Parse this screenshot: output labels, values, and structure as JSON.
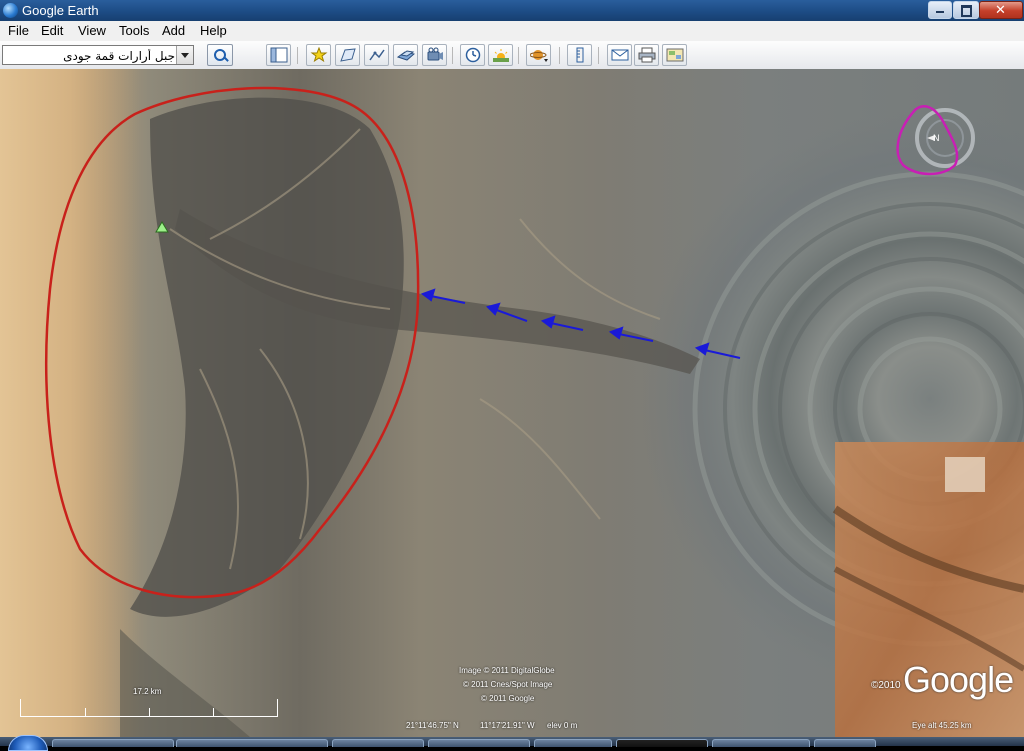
{
  "window": {
    "title": "Google Earth",
    "close_glyph": "✕"
  },
  "menu": {
    "items": [
      "File",
      "Edit",
      "View",
      "Tools",
      "Add",
      "Help"
    ]
  },
  "search": {
    "value": "جبل أرارات قمة جودى"
  },
  "toolbar": {
    "buttons": [
      "sidebar-toggle-icon",
      "add-placemark-icon",
      "add-polygon-icon",
      "add-path-icon",
      "image-overlay-icon",
      "record-tour-icon",
      "historical-imagery-icon",
      "sunlight-icon",
      "switch-planet-icon",
      "ruler-icon",
      "email-icon",
      "print-icon",
      "view-in-maps-icon"
    ]
  },
  "map": {
    "credits": [
      "Image © 2011 DigitalGlobe",
      "© 2011 Cnes/Spot Image",
      "© 2011 Google"
    ],
    "copyright_year": "©2010",
    "logo_text": "Google",
    "scale_label": "17.2 km",
    "status": {
      "lat": "21°11'46.75\" N",
      "lon": "11°17'21.91\" W",
      "elev": "elev  0 m",
      "eye_alt": "Eye alt    45.25 km"
    },
    "annotation_colors": {
      "circle": "#c8211b",
      "arrows": "#1a1ad8",
      "compass_highlight": "#c81fb4"
    }
  }
}
